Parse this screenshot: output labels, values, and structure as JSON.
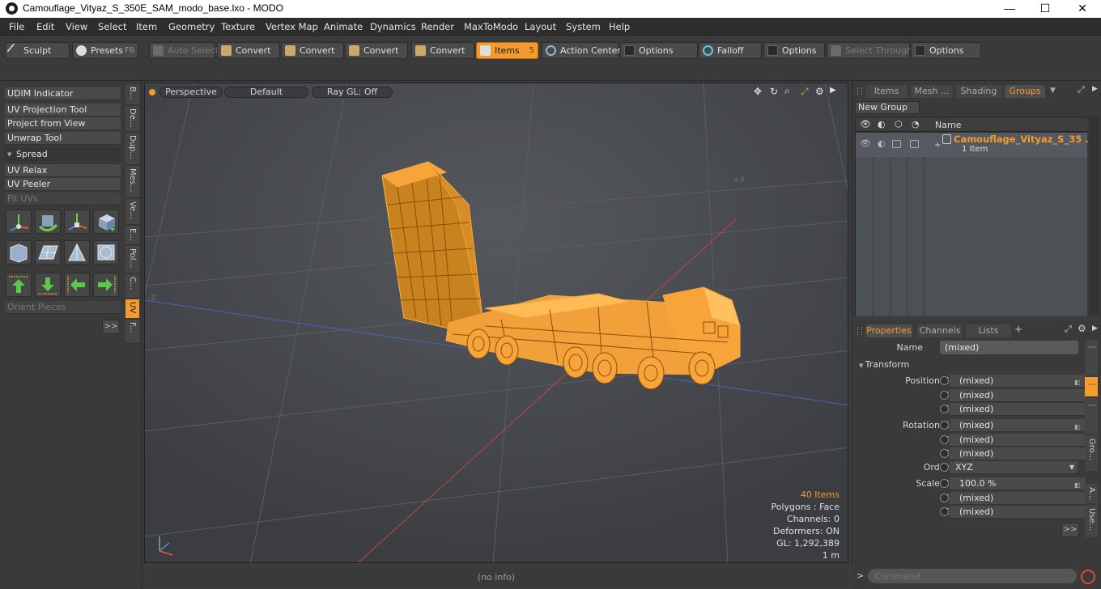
{
  "window": {
    "title": "Camouflage_Vityaz_S_350E_SAM_modo_base.lxo - MODO",
    "minimize": "—",
    "maximize": "☐",
    "close": "✕"
  },
  "menu": [
    "File",
    "Edit",
    "View",
    "Select",
    "Item",
    "Geometry",
    "Texture",
    "Vertex Map",
    "Animate",
    "Dynamics",
    "Render",
    "MaxToModo",
    "Layout",
    "System",
    "Help"
  ],
  "toolbar": {
    "sculpt": "Sculpt",
    "presets": "Presets",
    "presets_key": "F6",
    "auto_select": "Auto Select",
    "convert1": "Convert",
    "convert2": "Convert",
    "convert3": "Convert",
    "convert4": "Convert",
    "items": "Items",
    "items_key": "5",
    "action_center": "Action Center",
    "options1": "Options",
    "falloff": "Falloff",
    "options2": "Options",
    "select_through": "Select Through",
    "options3": "Options"
  },
  "left": {
    "tools": [
      "UDIM Indicator",
      "UV Projection Tool",
      "Project from View",
      "Unwrap Tool"
    ],
    "spread": "Spread",
    "tools2": [
      "UV Relax",
      "UV Peeler"
    ],
    "fit_uvs": "Fit UVs",
    "orient": "Orient Pieces",
    "more": ">>",
    "vtabs": [
      "B...",
      "De...",
      "Dup...",
      "Mes...",
      "Ve...",
      "E...",
      "Pol...",
      "C...",
      "UV",
      "F..."
    ]
  },
  "viewport": {
    "view": "Perspective",
    "shading": "Default",
    "raygl": "Ray GL: Off",
    "stats": {
      "items": "40 Items",
      "polygons": "Polygons : Face",
      "channels": "Channels: 0",
      "deformers": "Deformers: ON",
      "gl": "GL: 1,292,389",
      "scale": "1 m"
    },
    "axis_z": "-Z",
    "axis_x": "+X"
  },
  "status": "(no info)",
  "groups": {
    "tabs": [
      "Items",
      "Mesh ...",
      "Shading",
      "Groups"
    ],
    "new_group": "New Group",
    "col_name": "Name",
    "row_name": "Camouflage_Vityaz_S_35 ...",
    "row_sub": "1 Item"
  },
  "props": {
    "tabs": [
      "Properties",
      "Channels",
      "Lists"
    ],
    "add": "+",
    "name_label": "Name",
    "name_value": "(mixed)",
    "transform": "Transform",
    "position_x": "Position X",
    "rotation_x": "Rotation X",
    "y": "Y",
    "z": "Z",
    "order": "Order",
    "order_value": "XYZ",
    "scale_x": "Scale X",
    "mixed": "(mixed)",
    "scale_value": "100.0 %",
    "more": ">>",
    "sidetabs": [
      "Gro...",
      "A...",
      "Use..."
    ]
  },
  "command": {
    "prompt": ">",
    "placeholder": "Command"
  },
  "colors": {
    "accent": "#f39c2d",
    "wire": "#f7a53a",
    "bg": "#3a3a3a",
    "viewport": "#46494d"
  }
}
